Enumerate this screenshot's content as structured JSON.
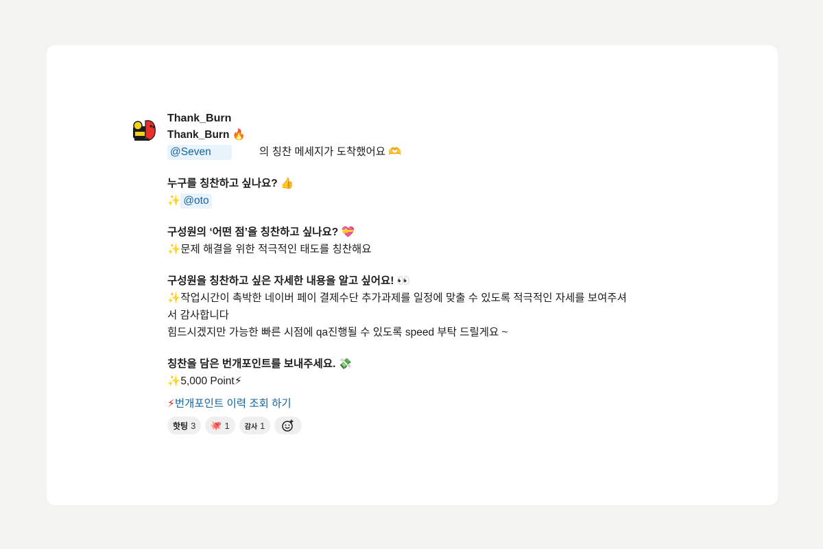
{
  "message": {
    "sender": "Thank_Burn",
    "title": "Thank_Burn",
    "title_emoji": "🔥",
    "mention_from": "@Seven",
    "arrived_text": "의 칭찬 메세지가 도착했어요",
    "arrived_emoji": "🫶",
    "q1": "누구를 칭찬하고 싶나요?",
    "q1_emoji": "👍",
    "a1_prefix": "✨",
    "a1_mention": "@oto",
    "q2": "구성원의 ‘어떤 점’을 칭찬하고 싶나요?",
    "q2_emoji": "💝",
    "a2": "✨문제 해결을 위한 적극적인 태도를 칭찬해요",
    "q3": "구성원을 칭찬하고 싶은 자세한 내용을 알고 싶어요!",
    "q3_emoji": "👀",
    "a3_line1": "✨작업시간이 촉박한 네이버 페이 결제수단 추가과제를 일정에 맞출 수 있도록 적극적인 자세를 보여주셔",
    "a3_line2": "서 감사합니다",
    "a3_line3": "힘드시겠지만 가능한 빠른 시점에 qa진행될 수 있도록 speed 부탁 드릴게요 ~",
    "q4": "칭찬을 담은 번개포인트를 보내주세요.",
    "q4_emoji": "💸",
    "a4_prefix": "✨",
    "a4_points": "5,000 Point",
    "a4_suffix": "⚡",
    "history_icon": "⚡",
    "history_link": "번개포인트 이력 조회 하기"
  },
  "reactions": [
    {
      "icon": "핫팅",
      "count": "3"
    },
    {
      "icon": "🐙",
      "count": "1"
    },
    {
      "icon": "감사",
      "count": "1"
    }
  ],
  "add_reaction_icon": "smiley-plus-icon",
  "colors": {
    "link": "#1264a3",
    "mention_bg": "#e8f3fb",
    "page_bg": "#f3f3f2"
  }
}
